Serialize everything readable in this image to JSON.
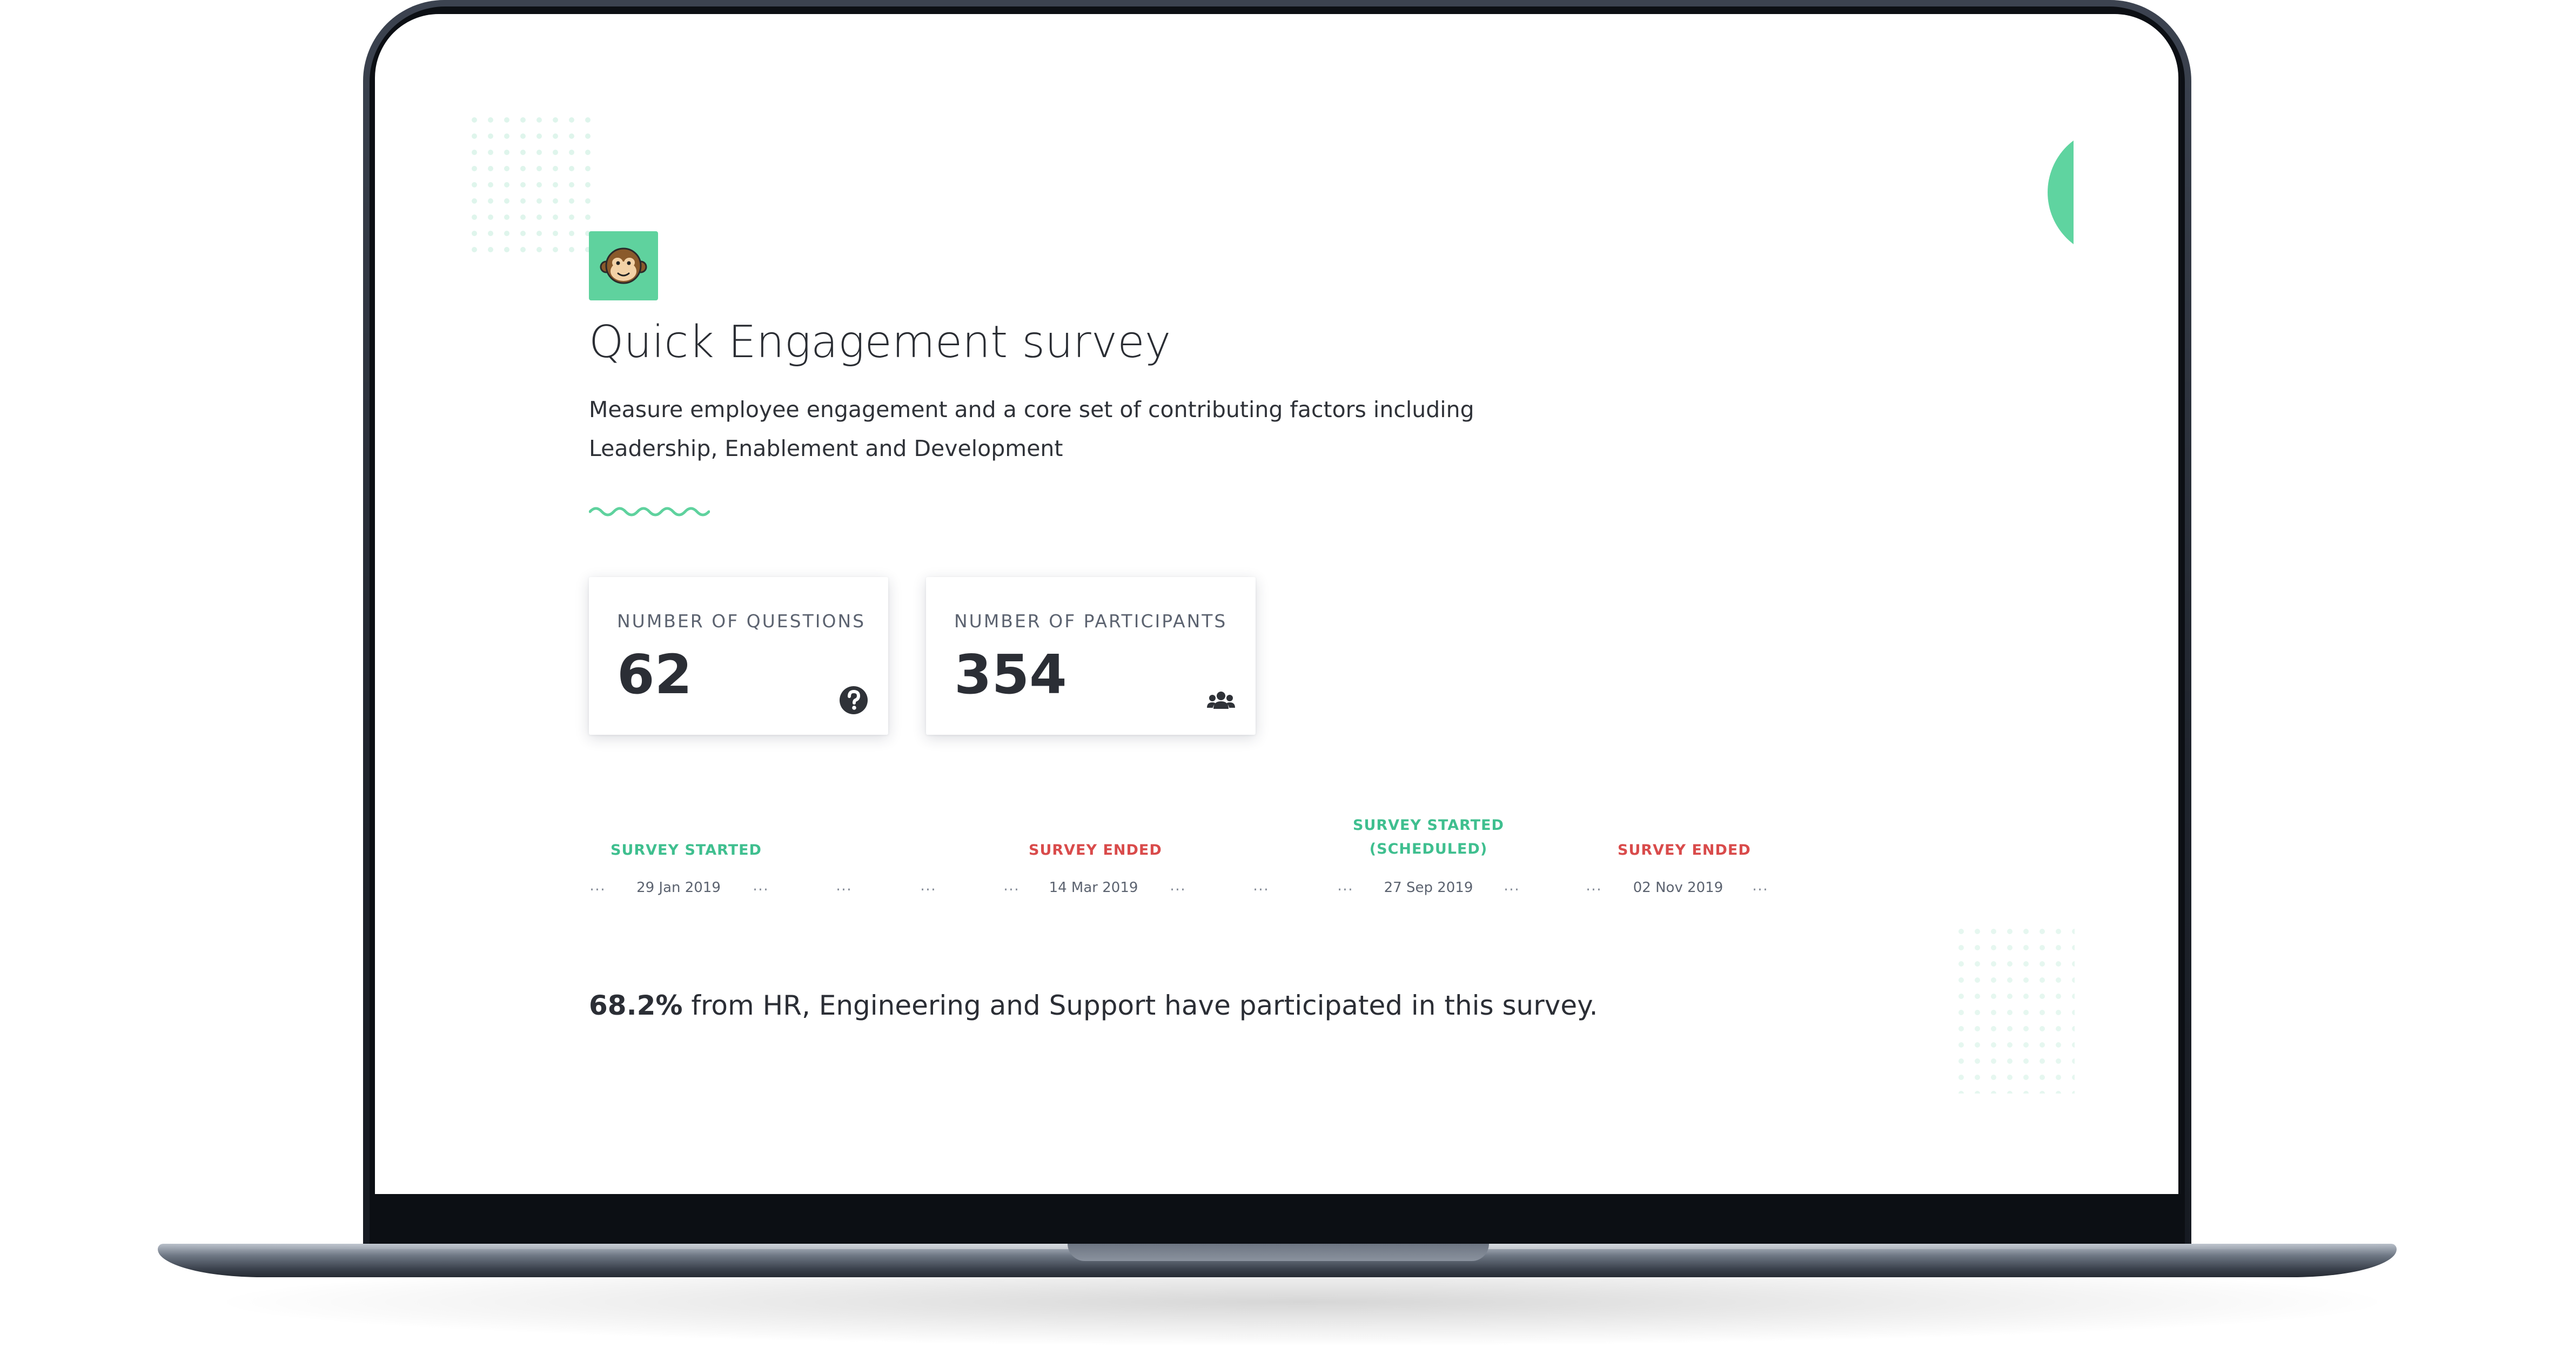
{
  "survey": {
    "logo_icon": "monkey-face-icon",
    "title": "Quick Engagement survey",
    "description_line1": "Measure employee engagement and a core set of contributing factors including",
    "description_line2": "Leadership, Enablement and Development"
  },
  "stats": {
    "questions": {
      "label": "NUMBER OF QUESTIONS",
      "value": "62",
      "icon": "question-circle-icon"
    },
    "participants": {
      "label": "NUMBER OF PARTICIPANTS",
      "value": "354",
      "icon": "users-icon"
    }
  },
  "timeline": {
    "events": [
      {
        "label_line1": "SURVEY STARTED",
        "label_line2": "",
        "status": "started",
        "date": "29 Jan 2019"
      },
      {
        "label_line1": "SURVEY ENDED",
        "label_line2": "",
        "status": "ended",
        "date": "14 Mar 2019"
      },
      {
        "label_line1": "SURVEY STARTED",
        "label_line2": "(SCHEDULED)",
        "status": "started",
        "date": "27 Sep 2019"
      },
      {
        "label_line1": "SURVEY ENDED",
        "label_line2": "",
        "status": "ended",
        "date": "02 Nov 2019"
      }
    ],
    "ellipsis": "..."
  },
  "summary": {
    "percent": "68.2%",
    "text": " from HR, Engineering and Support have participated in this survey."
  },
  "colors": {
    "accent_green": "#5fd29e",
    "started_green": "#3fbf8f",
    "ended_red": "#d94b4b",
    "text_dark": "#2b2e35"
  }
}
